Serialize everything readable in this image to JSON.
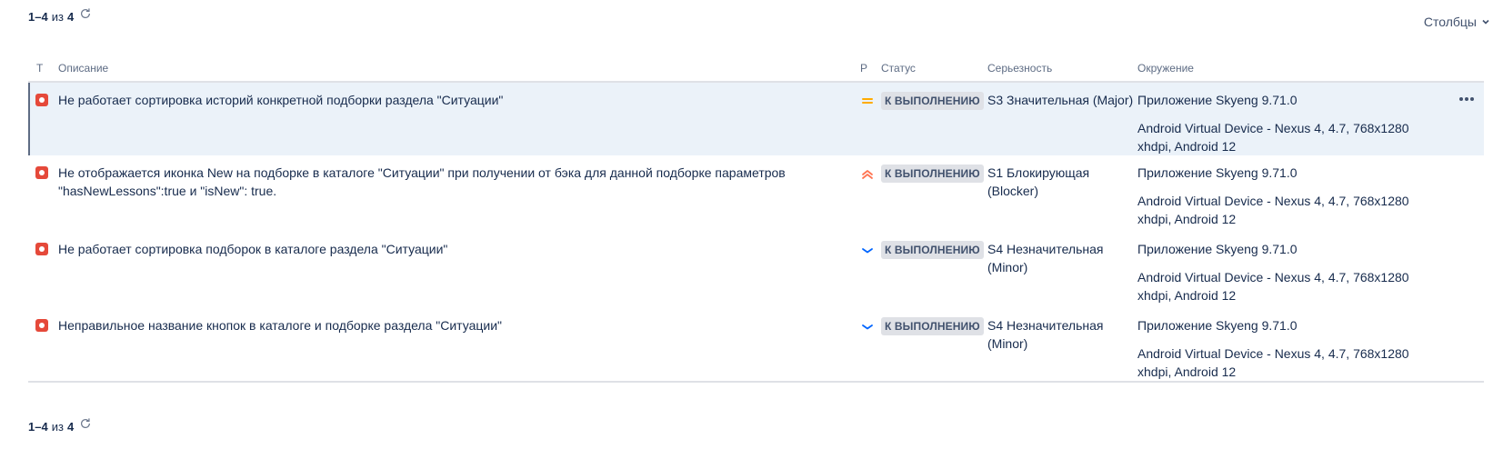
{
  "pager": {
    "range": "1–4",
    "of": "из",
    "total": "4"
  },
  "columns_button": {
    "label": "Столбцы",
    "icon": "chevron-down-icon"
  },
  "table": {
    "headers": {
      "type": "T",
      "description": "Описание",
      "priority": "P",
      "status": "Статус",
      "severity": "Серьезность",
      "environment": "Окружение"
    },
    "rows": [
      {
        "type_icon": "bug-icon",
        "description": "Не работает сортировка историй конкретной подборки раздела \"Ситуации\"",
        "priority": "medium",
        "priority_icon": "priority-medium-icon",
        "status": "К ВЫПОЛНЕНИЮ",
        "severity": "S3 Значительная (Major)",
        "env_app": "Приложение Skyeng 9.71.0",
        "env_device": "Android Virtual Device - Nexus 4, 4.7, 768x1280 xhdpi, Android 12",
        "selected": true
      },
      {
        "type_icon": "bug-icon",
        "description": "Не отображается иконка New на подборке в каталоге \"Ситуации\" при получении от бэка для данной подборке параметров \"hasNewLessons\":true и \"isNew\": true.",
        "priority": "highest",
        "priority_icon": "priority-highest-icon",
        "status": "К ВЫПОЛНЕНИЮ",
        "severity": "S1 Блокирующая (Blocker)",
        "env_app": "Приложение Skyeng 9.71.0",
        "env_device": "Android Virtual Device - Nexus 4, 4.7, 768x1280 xhdpi, Android 12",
        "selected": false
      },
      {
        "type_icon": "bug-icon",
        "description": "Не работает сортировка подборок в каталоге раздела \"Ситуации\"",
        "priority": "low",
        "priority_icon": "priority-low-icon",
        "status": "К ВЫПОЛНЕНИЮ",
        "severity": "S4 Незначительная (Minor)",
        "env_app": "Приложение Skyeng 9.71.0",
        "env_device": "Android Virtual Device - Nexus 4, 4.7, 768x1280 xhdpi, Android 12",
        "selected": false
      },
      {
        "type_icon": "bug-icon",
        "description": "Неправильное название кнопок в каталоге и подборке раздела \"Ситуации\"",
        "priority": "low",
        "priority_icon": "priority-low-icon",
        "status": "К ВЫПОЛНЕНИЮ",
        "severity": "S4 Незначительная (Minor)",
        "env_app": "Приложение Skyeng 9.71.0",
        "env_device": "Android Virtual Device - Nexus 4, 4.7, 768x1280 xhdpi, Android 12",
        "selected": false
      }
    ]
  },
  "colors": {
    "text": "#172b4d",
    "muted": "#5e6c84",
    "selected_row": "#ebf2f9",
    "bug": "#e5493a",
    "priority_medium": "#ffab00",
    "priority_highest": "#ff7452",
    "priority_low": "#0065ff",
    "status_bg": "#dfe1e6"
  }
}
